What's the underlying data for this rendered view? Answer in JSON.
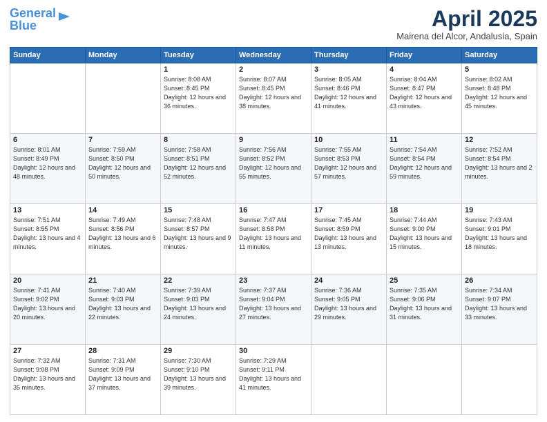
{
  "header": {
    "logo_line1": "General",
    "logo_line2": "Blue",
    "month": "April 2025",
    "location": "Mairena del Alcor, Andalusia, Spain"
  },
  "weekdays": [
    "Sunday",
    "Monday",
    "Tuesday",
    "Wednesday",
    "Thursday",
    "Friday",
    "Saturday"
  ],
  "weeks": [
    [
      {
        "day": "",
        "sunrise": "",
        "sunset": "",
        "daylight": ""
      },
      {
        "day": "",
        "sunrise": "",
        "sunset": "",
        "daylight": ""
      },
      {
        "day": "1",
        "sunrise": "Sunrise: 8:08 AM",
        "sunset": "Sunset: 8:45 PM",
        "daylight": "Daylight: 12 hours and 36 minutes."
      },
      {
        "day": "2",
        "sunrise": "Sunrise: 8:07 AM",
        "sunset": "Sunset: 8:45 PM",
        "daylight": "Daylight: 12 hours and 38 minutes."
      },
      {
        "day": "3",
        "sunrise": "Sunrise: 8:05 AM",
        "sunset": "Sunset: 8:46 PM",
        "daylight": "Daylight: 12 hours and 41 minutes."
      },
      {
        "day": "4",
        "sunrise": "Sunrise: 8:04 AM",
        "sunset": "Sunset: 8:47 PM",
        "daylight": "Daylight: 12 hours and 43 minutes."
      },
      {
        "day": "5",
        "sunrise": "Sunrise: 8:02 AM",
        "sunset": "Sunset: 8:48 PM",
        "daylight": "Daylight: 12 hours and 45 minutes."
      }
    ],
    [
      {
        "day": "6",
        "sunrise": "Sunrise: 8:01 AM",
        "sunset": "Sunset: 8:49 PM",
        "daylight": "Daylight: 12 hours and 48 minutes."
      },
      {
        "day": "7",
        "sunrise": "Sunrise: 7:59 AM",
        "sunset": "Sunset: 8:50 PM",
        "daylight": "Daylight: 12 hours and 50 minutes."
      },
      {
        "day": "8",
        "sunrise": "Sunrise: 7:58 AM",
        "sunset": "Sunset: 8:51 PM",
        "daylight": "Daylight: 12 hours and 52 minutes."
      },
      {
        "day": "9",
        "sunrise": "Sunrise: 7:56 AM",
        "sunset": "Sunset: 8:52 PM",
        "daylight": "Daylight: 12 hours and 55 minutes."
      },
      {
        "day": "10",
        "sunrise": "Sunrise: 7:55 AM",
        "sunset": "Sunset: 8:53 PM",
        "daylight": "Daylight: 12 hours and 57 minutes."
      },
      {
        "day": "11",
        "sunrise": "Sunrise: 7:54 AM",
        "sunset": "Sunset: 8:54 PM",
        "daylight": "Daylight: 12 hours and 59 minutes."
      },
      {
        "day": "12",
        "sunrise": "Sunrise: 7:52 AM",
        "sunset": "Sunset: 8:54 PM",
        "daylight": "Daylight: 13 hours and 2 minutes."
      }
    ],
    [
      {
        "day": "13",
        "sunrise": "Sunrise: 7:51 AM",
        "sunset": "Sunset: 8:55 PM",
        "daylight": "Daylight: 13 hours and 4 minutes."
      },
      {
        "day": "14",
        "sunrise": "Sunrise: 7:49 AM",
        "sunset": "Sunset: 8:56 PM",
        "daylight": "Daylight: 13 hours and 6 minutes."
      },
      {
        "day": "15",
        "sunrise": "Sunrise: 7:48 AM",
        "sunset": "Sunset: 8:57 PM",
        "daylight": "Daylight: 13 hours and 9 minutes."
      },
      {
        "day": "16",
        "sunrise": "Sunrise: 7:47 AM",
        "sunset": "Sunset: 8:58 PM",
        "daylight": "Daylight: 13 hours and 11 minutes."
      },
      {
        "day": "17",
        "sunrise": "Sunrise: 7:45 AM",
        "sunset": "Sunset: 8:59 PM",
        "daylight": "Daylight: 13 hours and 13 minutes."
      },
      {
        "day": "18",
        "sunrise": "Sunrise: 7:44 AM",
        "sunset": "Sunset: 9:00 PM",
        "daylight": "Daylight: 13 hours and 15 minutes."
      },
      {
        "day": "19",
        "sunrise": "Sunrise: 7:43 AM",
        "sunset": "Sunset: 9:01 PM",
        "daylight": "Daylight: 13 hours and 18 minutes."
      }
    ],
    [
      {
        "day": "20",
        "sunrise": "Sunrise: 7:41 AM",
        "sunset": "Sunset: 9:02 PM",
        "daylight": "Daylight: 13 hours and 20 minutes."
      },
      {
        "day": "21",
        "sunrise": "Sunrise: 7:40 AM",
        "sunset": "Sunset: 9:03 PM",
        "daylight": "Daylight: 13 hours and 22 minutes."
      },
      {
        "day": "22",
        "sunrise": "Sunrise: 7:39 AM",
        "sunset": "Sunset: 9:03 PM",
        "daylight": "Daylight: 13 hours and 24 minutes."
      },
      {
        "day": "23",
        "sunrise": "Sunrise: 7:37 AM",
        "sunset": "Sunset: 9:04 PM",
        "daylight": "Daylight: 13 hours and 27 minutes."
      },
      {
        "day": "24",
        "sunrise": "Sunrise: 7:36 AM",
        "sunset": "Sunset: 9:05 PM",
        "daylight": "Daylight: 13 hours and 29 minutes."
      },
      {
        "day": "25",
        "sunrise": "Sunrise: 7:35 AM",
        "sunset": "Sunset: 9:06 PM",
        "daylight": "Daylight: 13 hours and 31 minutes."
      },
      {
        "day": "26",
        "sunrise": "Sunrise: 7:34 AM",
        "sunset": "Sunset: 9:07 PM",
        "daylight": "Daylight: 13 hours and 33 minutes."
      }
    ],
    [
      {
        "day": "27",
        "sunrise": "Sunrise: 7:32 AM",
        "sunset": "Sunset: 9:08 PM",
        "daylight": "Daylight: 13 hours and 35 minutes."
      },
      {
        "day": "28",
        "sunrise": "Sunrise: 7:31 AM",
        "sunset": "Sunset: 9:09 PM",
        "daylight": "Daylight: 13 hours and 37 minutes."
      },
      {
        "day": "29",
        "sunrise": "Sunrise: 7:30 AM",
        "sunset": "Sunset: 9:10 PM",
        "daylight": "Daylight: 13 hours and 39 minutes."
      },
      {
        "day": "30",
        "sunrise": "Sunrise: 7:29 AM",
        "sunset": "Sunset: 9:11 PM",
        "daylight": "Daylight: 13 hours and 41 minutes."
      },
      {
        "day": "",
        "sunrise": "",
        "sunset": "",
        "daylight": ""
      },
      {
        "day": "",
        "sunrise": "",
        "sunset": "",
        "daylight": ""
      },
      {
        "day": "",
        "sunrise": "",
        "sunset": "",
        "daylight": ""
      }
    ]
  ]
}
